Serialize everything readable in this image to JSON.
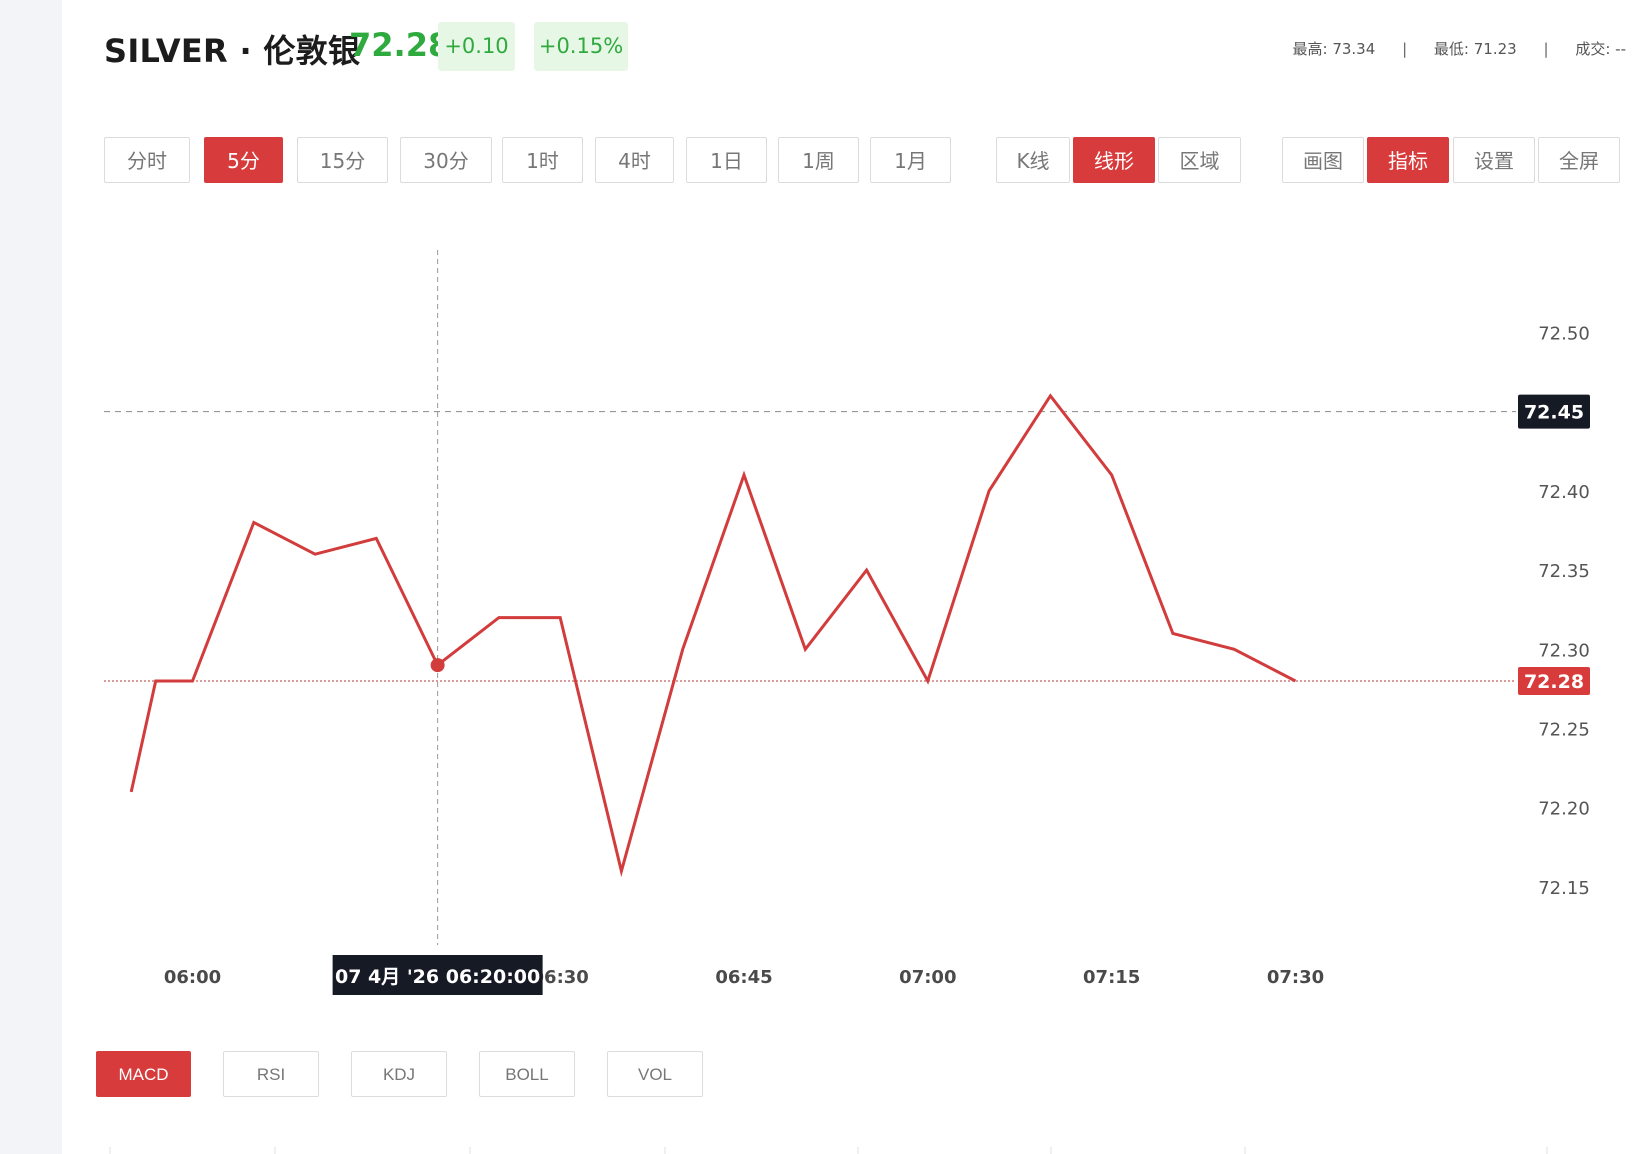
{
  "header": {
    "title": "SILVER · 伦敦银",
    "price": "72.28",
    "change": "+0.10",
    "change_pct": "+0.15%",
    "high_label": "最高:",
    "high_value": "73.34",
    "low_label": "最低:",
    "low_value": "71.23",
    "vol_label": "成交:",
    "vol_value": "--"
  },
  "timeframes": [
    {
      "label": "分时",
      "active": false
    },
    {
      "label": "5分",
      "active": true
    },
    {
      "label": "15分",
      "active": false
    },
    {
      "label": "30分",
      "active": false
    },
    {
      "label": "1时",
      "active": false
    },
    {
      "label": "4时",
      "active": false
    },
    {
      "label": "1日",
      "active": false
    },
    {
      "label": "1周",
      "active": false
    },
    {
      "label": "1月",
      "active": false
    }
  ],
  "chart_types": [
    {
      "label": "K线",
      "active": false
    },
    {
      "label": "线形",
      "active": true
    },
    {
      "label": "区域",
      "active": false
    }
  ],
  "tools": [
    {
      "label": "画图",
      "active": false
    },
    {
      "label": "指标",
      "active": true
    },
    {
      "label": "设置",
      "active": false
    },
    {
      "label": "全屏",
      "active": false
    }
  ],
  "indicators": [
    {
      "label": "MACD",
      "active": true
    },
    {
      "label": "RSI",
      "active": false
    },
    {
      "label": "KDJ",
      "active": false
    },
    {
      "label": "BOLL",
      "active": false
    },
    {
      "label": "VOL",
      "active": false
    }
  ],
  "colors": {
    "accent": "#d73b3b",
    "up": "#2faa3f",
    "line": "#d23c3c",
    "crosshair_label_bg": "#161a25"
  },
  "chart_data": {
    "type": "line",
    "x": [
      "05:55",
      "05:57",
      "06:00",
      "06:05",
      "06:10",
      "06:15",
      "06:20",
      "06:25",
      "06:30",
      "06:35",
      "06:40",
      "06:45",
      "06:50",
      "06:55",
      "07:00",
      "07:05",
      "07:10",
      "07:15",
      "07:20",
      "07:25",
      "07:30"
    ],
    "values": [
      72.21,
      72.28,
      72.28,
      72.38,
      72.36,
      72.37,
      72.29,
      72.32,
      72.32,
      72.16,
      72.3,
      72.41,
      72.3,
      72.35,
      72.28,
      72.4,
      72.46,
      72.41,
      72.31,
      72.3,
      72.28
    ],
    "y_ticks": [
      "72.50",
      "72.45",
      "72.40",
      "72.35",
      "72.30",
      "72.28",
      "72.25",
      "72.20",
      "72.15"
    ],
    "x_ticks": [
      "06:00",
      "06:15",
      "06:30",
      "06:45",
      "07:00",
      "07:15",
      "07:30"
    ],
    "ylim": [
      72.126,
      72.552
    ],
    "last_price": "72.28",
    "crosshair_price": "72.45",
    "crosshair_time": "07 4月 '26   06:20:00",
    "crosshair_x": "06:20"
  }
}
